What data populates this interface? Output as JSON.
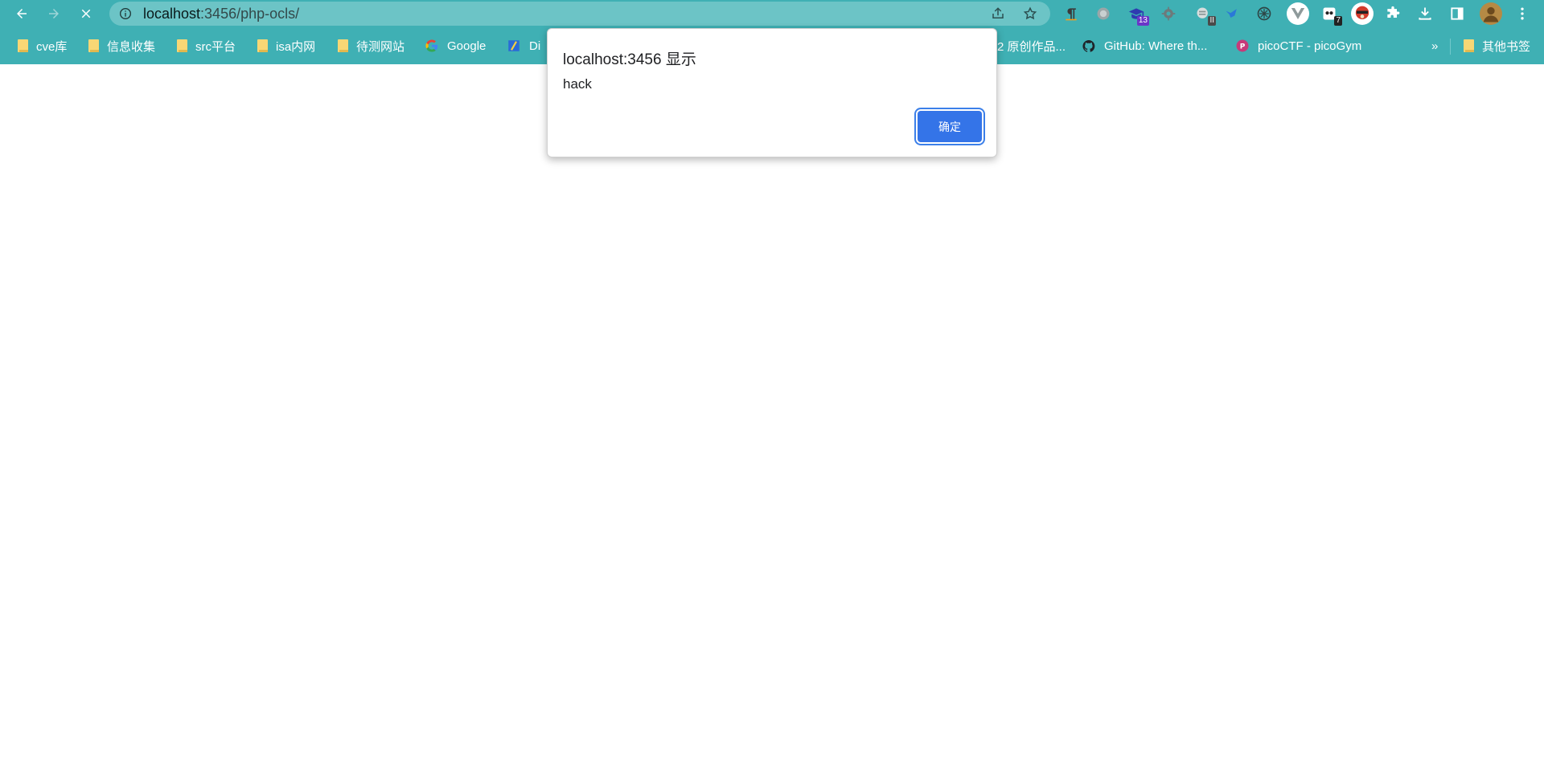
{
  "browser": {
    "url_host": "localhost",
    "url_rest": ":3456/php-ocls/",
    "extensions": [
      {
        "icon": "pilcrow-extension-icon"
      },
      {
        "icon": "circle-extension-icon"
      },
      {
        "icon": "graduation-cap-extension-icon",
        "badge": "13"
      },
      {
        "icon": "gear-extension-icon"
      },
      {
        "icon": "wappalyzer-extension-icon",
        "badge": "II"
      },
      {
        "icon": "bird-extension-icon"
      },
      {
        "icon": "compass-extension-icon"
      },
      {
        "icon": "vue-devtools-extension-icon"
      },
      {
        "icon": "panda-extension-icon",
        "badge": "7"
      },
      {
        "icon": "monocle-extension-icon"
      }
    ]
  },
  "bookmarks": {
    "items": [
      {
        "label": "cve库",
        "icon": "folder-icon"
      },
      {
        "label": "信息收集",
        "icon": "folder-icon"
      },
      {
        "label": "src平台",
        "icon": "folder-icon"
      },
      {
        "label": "isa内网",
        "icon": "folder-icon"
      },
      {
        "label": "待测网站",
        "icon": "folder-icon"
      },
      {
        "label": "Google",
        "icon": "google-icon"
      },
      {
        "label": "Di",
        "icon": "site-icon"
      },
      {
        "label": "2 原创作品...",
        "icon": "none"
      },
      {
        "label": "GitHub: Where th...",
        "icon": "github-icon"
      },
      {
        "label": "picoCTF - picoGym",
        "icon": "picoctf-icon"
      }
    ],
    "overflow_label": "»",
    "other_bookmarks_label": "其他书签"
  },
  "dialog": {
    "title": "localhost:3456 显示",
    "message": "hack",
    "ok_label": "确定"
  },
  "colors": {
    "toolbar_bg": "#3fb0b4",
    "omnibox_bg": "#6cc4c6",
    "ok_button": "#3474e8"
  }
}
